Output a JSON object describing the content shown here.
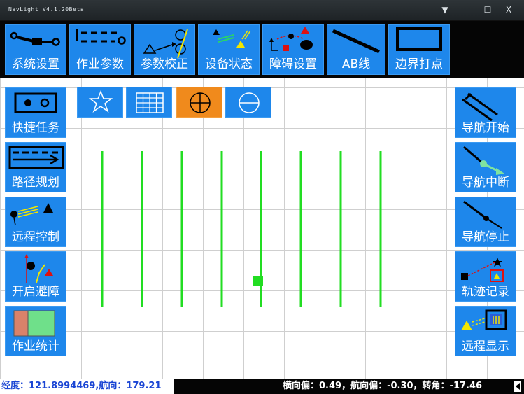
{
  "window": {
    "title": "NavLight V4.1.20Beta",
    "controls": [
      "▼",
      "–",
      "☐",
      "X"
    ]
  },
  "toolbar": {
    "buttons": [
      {
        "label": "系统设置",
        "icon": "settings-line-icon"
      },
      {
        "label": "作业参数",
        "icon": "work-params-icon"
      },
      {
        "label": "参数校正",
        "icon": "calibration-icon"
      },
      {
        "label": "设备状态",
        "icon": "device-status-icon"
      },
      {
        "label": "障碍设置",
        "icon": "obstacle-icon"
      },
      {
        "label": "AB线",
        "icon": "ab-line-icon"
      },
      {
        "label": "边界打点",
        "icon": "boundary-icon"
      }
    ]
  },
  "left_panel": {
    "buttons": [
      {
        "label": "快捷任务",
        "icon": "quick-task-icon"
      },
      {
        "label": "路径规划",
        "icon": "path-plan-icon"
      },
      {
        "label": "远程控制",
        "icon": "remote-control-icon"
      },
      {
        "label": "开启避障",
        "icon": "avoid-obstacle-icon"
      },
      {
        "label": "作业统计",
        "icon": "statistics-icon"
      }
    ]
  },
  "right_panel": {
    "buttons": [
      {
        "label": "导航开始",
        "icon": "nav-start-icon"
      },
      {
        "label": "导航中断",
        "icon": "nav-pause-icon"
      },
      {
        "label": "导航停止",
        "icon": "nav-stop-icon"
      },
      {
        "label": "轨迹记录",
        "icon": "track-record-icon"
      },
      {
        "label": "远程显示",
        "icon": "remote-display-icon"
      }
    ]
  },
  "view_modes": {
    "buttons": [
      {
        "name": "star",
        "icon": "star-icon",
        "active": false
      },
      {
        "name": "grid",
        "icon": "grid-icon",
        "active": false
      },
      {
        "name": "crosshair",
        "icon": "crosshair-icon",
        "active": true
      },
      {
        "name": "horizontal",
        "icon": "circle-minus-icon",
        "active": false
      }
    ]
  },
  "status": {
    "left": "经度：121.8994469,航向：179.21",
    "right": "横向偏：0.49，航向偏：-0.30，转角：-17.46"
  },
  "colors": {
    "button_blue": "#1e87eb",
    "active_orange": "#f08a1c",
    "path_green": "#22dd22",
    "status_blue": "#1a45d4"
  }
}
